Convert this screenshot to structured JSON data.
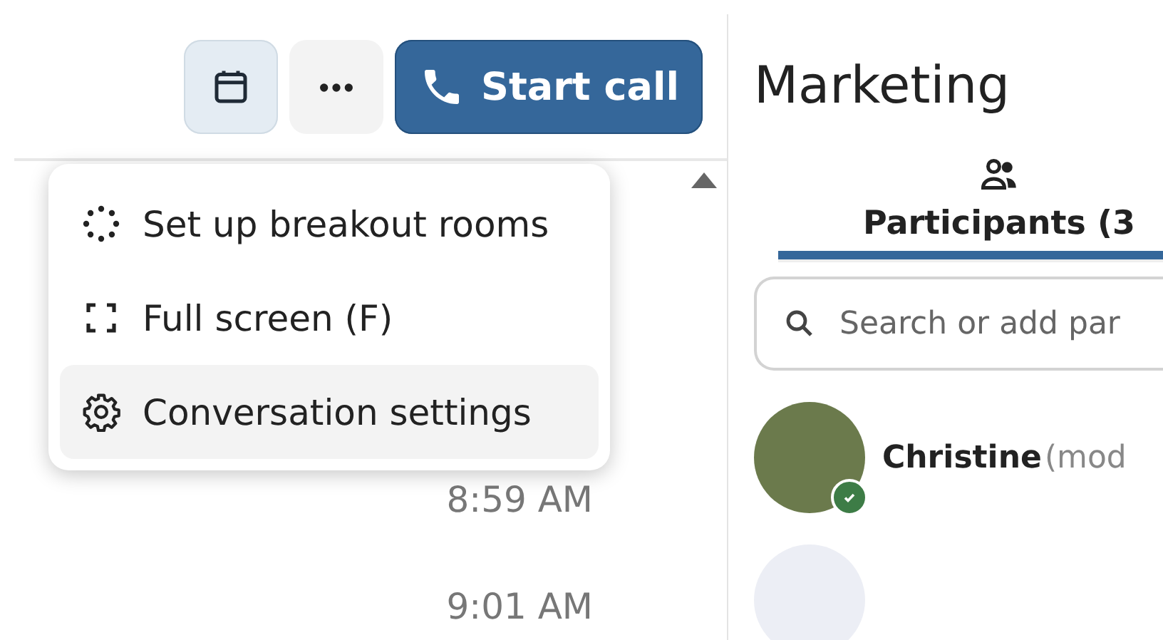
{
  "toolbar": {
    "buttons": [
      {
        "kind": "calendar",
        "pressed": true
      },
      {
        "kind": "more",
        "pressed": false
      },
      {
        "kind": "call",
        "label": "Start call"
      }
    ]
  },
  "menu": {
    "items": [
      {
        "kind": "breakout",
        "label": "Set up breakout rooms",
        "highlighted": false
      },
      {
        "kind": "fullscreen",
        "label": "Full screen (F)",
        "highlighted": false
      },
      {
        "kind": "settings",
        "label": "Conversation settings",
        "highlighted": true
      }
    ]
  },
  "messages": {
    "times": [
      "8:59 AM",
      "9:01 AM"
    ]
  },
  "sidebar": {
    "title": "Marketing",
    "tabs": [
      {
        "label": "Participants (3",
        "selected": true
      }
    ],
    "search": {
      "placeholder": "Search or add par"
    },
    "participants": [
      {
        "name": "Christine",
        "role": "(mod",
        "online": true
      },
      {
        "online": false
      }
    ]
  }
}
